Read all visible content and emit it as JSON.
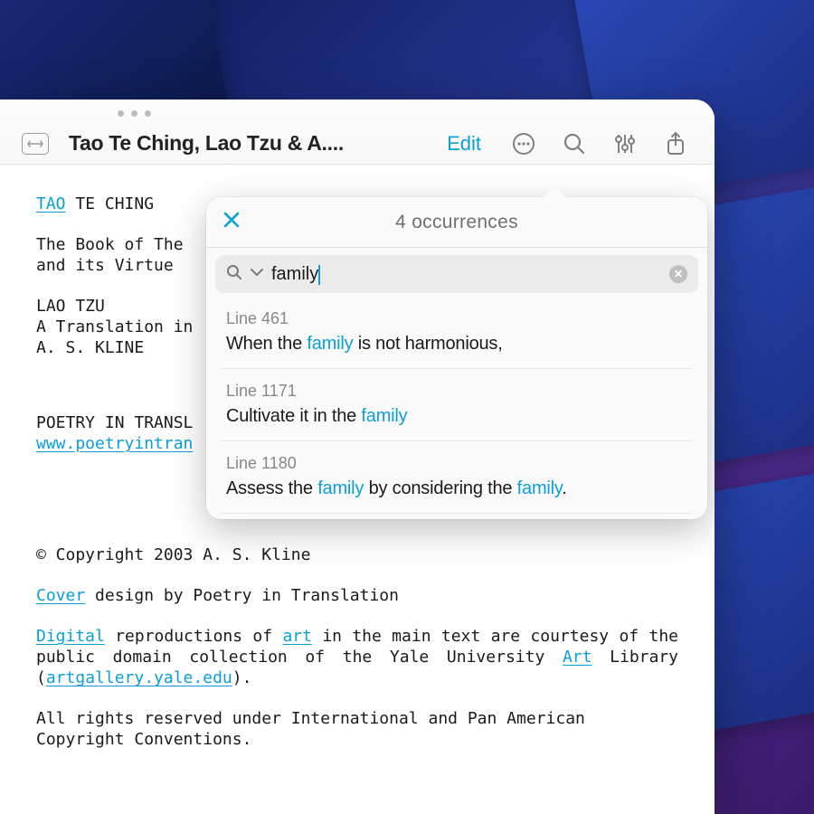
{
  "colors": {
    "accent": "#0aa0d6",
    "text": "#1a1a1a",
    "muted": "#808080"
  },
  "toolbar": {
    "doc_title": "Tao Te Ching, Lao Tzu & A....",
    "edit_label": "Edit"
  },
  "document": {
    "line1_tao": "TAO",
    "line1_rest": " TE CHING",
    "p2": "The Book of The\nand its Virtue",
    "p3": "LAO TZU\nA Translation in\nA. S. KLINE",
    "p4_prefix": "POETRY IN TRANSL",
    "p4_link": "www.poetryintran",
    "p5": "© Copyright 2003 A. S. Kline",
    "p6_cover": "Cover",
    "p6_rest": " design by Poetry in Translation",
    "p7_digital": "Digital",
    "p7_mid1": " reproductions of ",
    "p7_art1": "art",
    "p7_mid2": " in the main text are courtesy of the public domain collection of the Yale University ",
    "p7_art2": "Art",
    "p7_mid3": " Library (",
    "p7_url": "artgallery.yale.edu",
    "p7_end": ").",
    "p8": "All rights reserved under International and Pan American Copyright Conventions."
  },
  "search": {
    "header": "4 occurrences",
    "query": "family",
    "results": [
      {
        "line_label": "Line 461",
        "parts": [
          {
            "t": "When the ",
            "h": false
          },
          {
            "t": "family",
            "h": true
          },
          {
            "t": " is not harmonious,",
            "h": false
          }
        ]
      },
      {
        "line_label": "Line 1171",
        "parts": [
          {
            "t": "Cultivate it in the ",
            "h": false
          },
          {
            "t": "family",
            "h": true
          }
        ]
      },
      {
        "line_label": "Line 1180",
        "parts": [
          {
            "t": "Assess the ",
            "h": false
          },
          {
            "t": "family",
            "h": true
          },
          {
            "t": " by considering the ",
            "h": false
          },
          {
            "t": "family",
            "h": true
          },
          {
            "t": ".",
            "h": false
          }
        ]
      }
    ]
  }
}
